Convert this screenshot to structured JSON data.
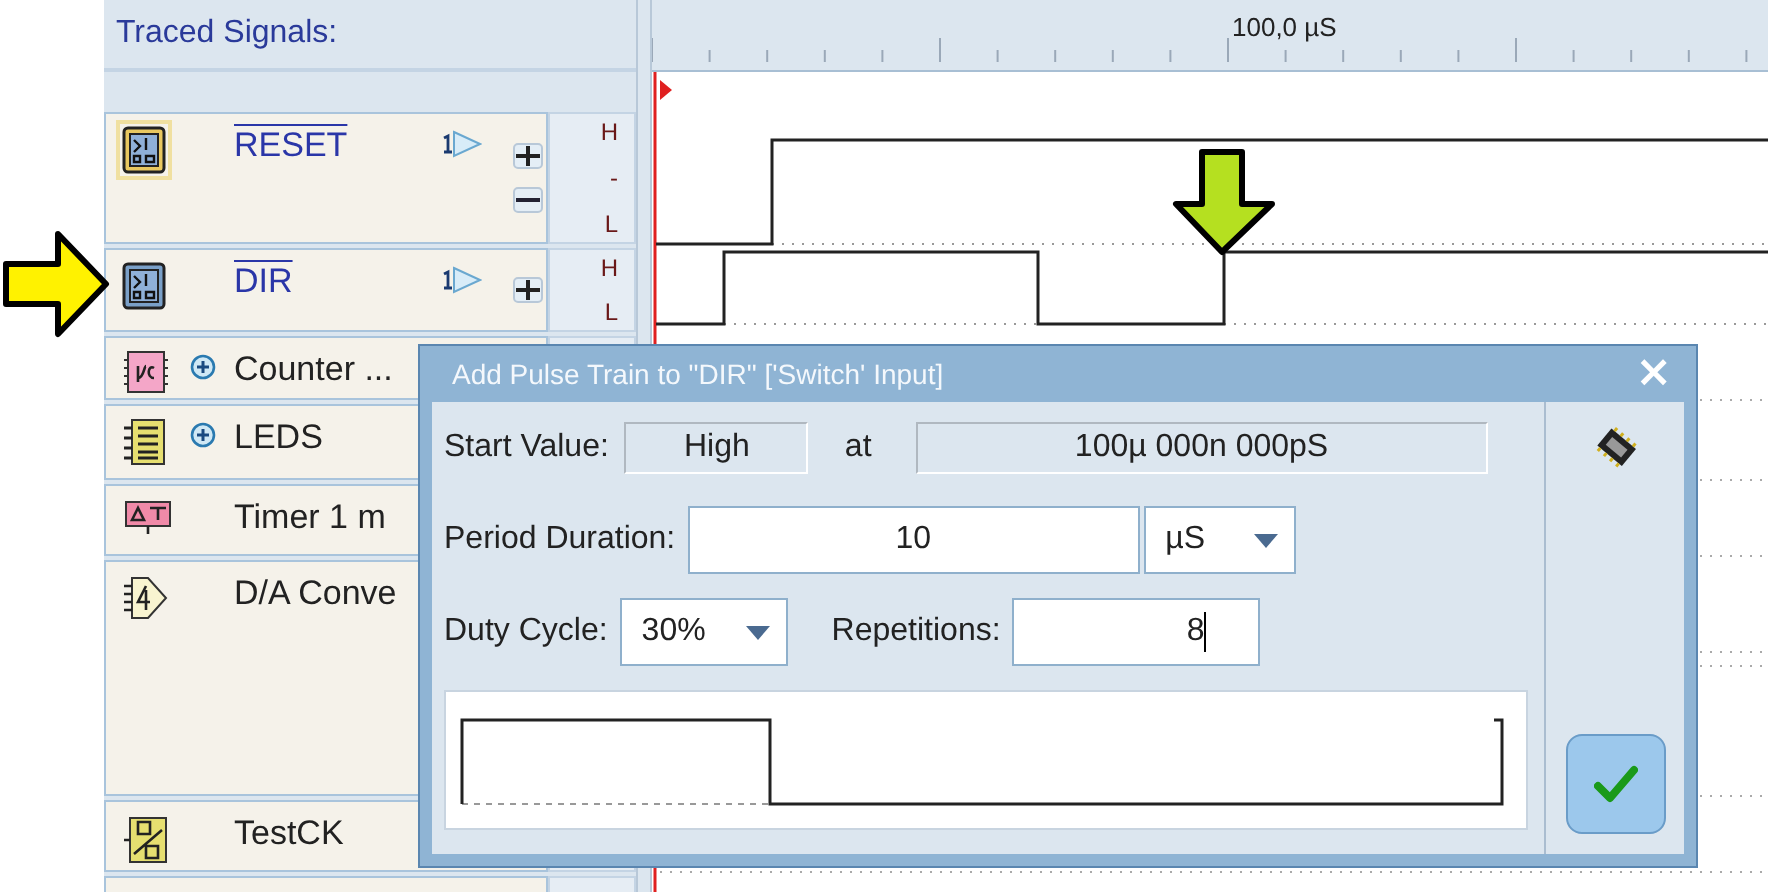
{
  "panel_title": "Traced Signals:",
  "signals": [
    {
      "name": "RESET",
      "kind": "switch",
      "overline": true,
      "highlighted": true,
      "expandable": false,
      "probe": true,
      "plus_button": true,
      "minus_button": true,
      "levels": [
        "H",
        "-",
        "L"
      ]
    },
    {
      "name": "DIR",
      "kind": "switch",
      "overline": true,
      "highlighted": false,
      "expandable": false,
      "probe": true,
      "plus_button": true,
      "minus_button": false,
      "levels": [
        "H",
        "L"
      ]
    },
    {
      "name": "Counter ...",
      "kind": "counter",
      "overline": false,
      "expandable": true
    },
    {
      "name": "LEDS",
      "kind": "leds",
      "overline": false,
      "expandable": true
    },
    {
      "name": "Timer 1 m",
      "kind": "timer",
      "overline": false
    },
    {
      "name": "D/A Conve",
      "kind": "dac",
      "overline": false
    },
    {
      "name": "TestCK",
      "kind": "clock",
      "overline": false
    }
  ],
  "ruler": {
    "label": "100,0 µS"
  },
  "dialog": {
    "title": "Add Pulse Train to \"DIR\" ['Switch' Input]",
    "close": "×",
    "start_label": "Start Value:",
    "start_value": "High",
    "at_label": "at",
    "at_value": "100µ 000n 000pS",
    "period_label": "Period Duration:",
    "period_value": "10",
    "period_unit": "µS",
    "duty_label": "Duty Cycle:",
    "duty_value": "30%",
    "repetitions_label": "Repetitions:",
    "repetitions_value": "8"
  }
}
